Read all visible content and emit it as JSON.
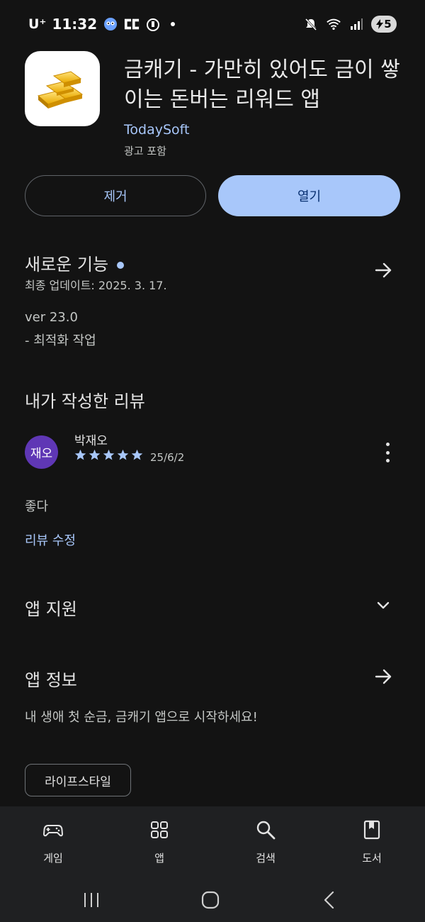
{
  "status_bar": {
    "carrier": "U⁺",
    "time": "11:32",
    "battery_level": "5"
  },
  "app": {
    "title": "금캐기 - 가만히 있어도 금이 쌓이는 돈버는 리워드 앱",
    "developer": "TodaySoft",
    "ads_note": "광고 포함",
    "icon": "gold-bars-icon"
  },
  "actions": {
    "remove_label": "제거",
    "open_label": "열기"
  },
  "whats_new": {
    "title": "새로운 기능",
    "last_updated": "최종 업데이트: 2025. 3. 17.",
    "version": "ver 23.0",
    "notes": "- 최적화 작업"
  },
  "my_review": {
    "title": "내가 작성한 리뷰",
    "avatar_text": "재오",
    "reviewer_name": "박재오",
    "rating": 5,
    "date": "25/6/2",
    "text": "좋다",
    "edit_label": "리뷰 수정"
  },
  "app_support": {
    "title": "앱 지원"
  },
  "app_info": {
    "title": "앱 정보",
    "description": "내 생애 첫 순금, 금캐기 앱으로 시작하세요!",
    "category": "라이프스타일"
  },
  "bottom_nav": {
    "items": [
      {
        "label": "게임",
        "icon": "gamepad-icon"
      },
      {
        "label": "앱",
        "icon": "apps-grid-icon"
      },
      {
        "label": "검색",
        "icon": "search-icon"
      },
      {
        "label": "도서",
        "icon": "book-icon"
      }
    ]
  },
  "colors": {
    "background": "#131313",
    "accent": "#a8c7fa",
    "avatar": "#5f37b5",
    "nav_background": "#1f2022"
  }
}
